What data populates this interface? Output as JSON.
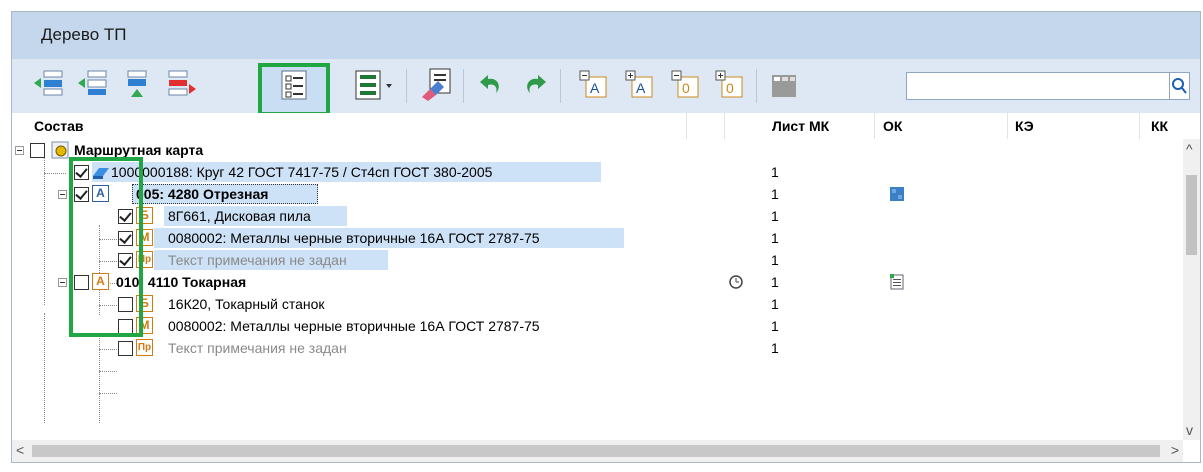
{
  "panel": {
    "title": "Дерево ТП"
  },
  "toolbar": {
    "buttons": [
      {
        "name": "insert-before-icon"
      },
      {
        "name": "insert-after-icon"
      },
      {
        "name": "move-down-icon"
      },
      {
        "name": "move-out-icon"
      },
      {
        "name": "checklist-icon",
        "active": true
      },
      {
        "name": "list-options-icon"
      },
      {
        "name": "edit-eraser-icon"
      },
      {
        "name": "undo-icon"
      },
      {
        "name": "redo-icon"
      },
      {
        "name": "collapse-a-icon"
      },
      {
        "name": "expand-a-icon"
      },
      {
        "name": "collapse-o-icon"
      },
      {
        "name": "expand-o-icon"
      },
      {
        "name": "table-icon"
      }
    ],
    "search_value": ""
  },
  "columns": {
    "c1": "Состав",
    "c2": "Лист МК",
    "c3": "ОК",
    "c4": "КЭ",
    "c5": "КК"
  },
  "rows": [
    {
      "text": "Маршрутная карта",
      "sheet": ""
    },
    {
      "text": "1000000188: Круг 42 ГОСТ 7417-75 / Ст4сп ГОСТ 380-2005",
      "sheet": "1"
    },
    {
      "text": "005: 4280 Отрезная",
      "badge": "А",
      "sheet": "1"
    },
    {
      "text": "8Г661, Дисковая пила",
      "badge": "Б",
      "sheet": "1"
    },
    {
      "text": "0080002: Металлы черные вторичные 16А ГОСТ 2787-75",
      "badge": "М",
      "sheet": "1"
    },
    {
      "text": "Текст примечания не задан",
      "badge": "Пр",
      "sheet": "1"
    },
    {
      "text": "010: 4110 Токарная",
      "badge": "А",
      "sheet": "1"
    },
    {
      "text": "16К20, Токарный станок",
      "badge": "Б",
      "sheet": "1"
    },
    {
      "text": "0080002: Металлы черные вторичные 16А ГОСТ 2787-75",
      "badge": "М",
      "sheet": "1"
    },
    {
      "text": "Текст примечания не задан",
      "badge": "Пр",
      "sheet": "1"
    }
  ],
  "colors": {
    "title_bg": "#c4d7ec",
    "toolbar_bg": "#dde8f4",
    "selection": "#cde1f7",
    "highlight": "#21a644"
  }
}
